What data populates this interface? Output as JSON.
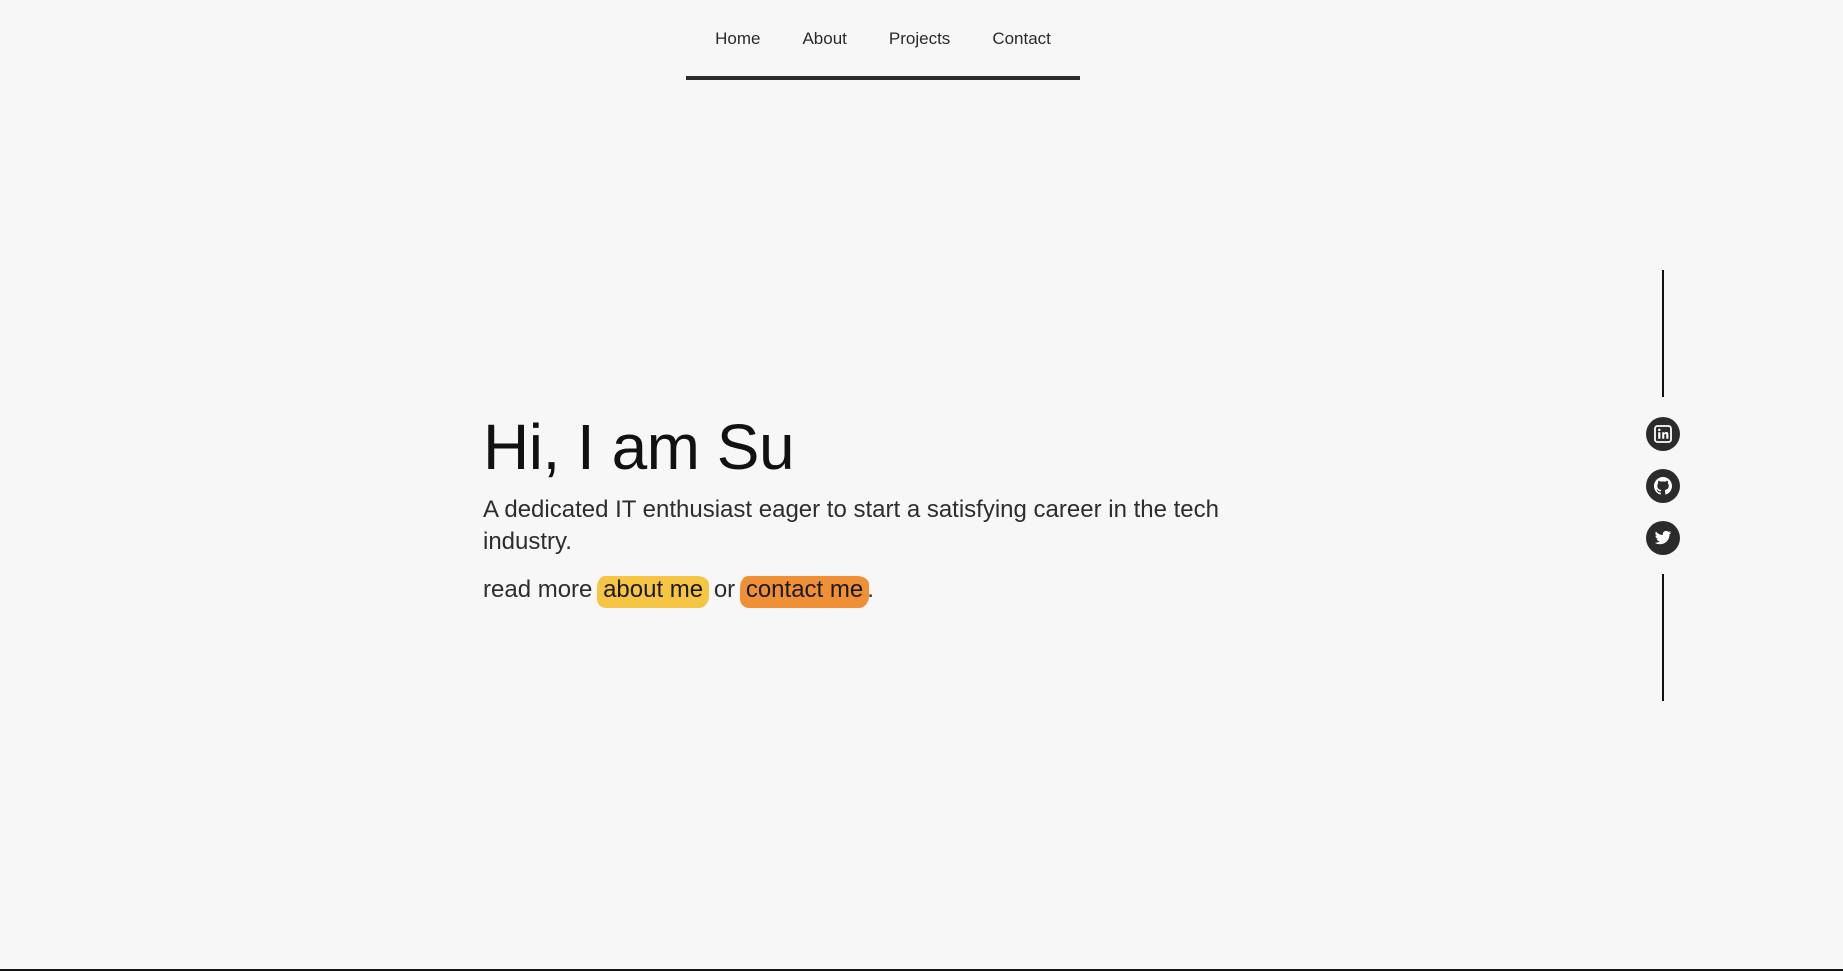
{
  "nav": {
    "items": [
      {
        "label": "Home"
      },
      {
        "label": "About"
      },
      {
        "label": "Projects"
      },
      {
        "label": "Contact"
      }
    ]
  },
  "hero": {
    "title": "Hi, I am Su",
    "subtitle": "A dedicated IT enthusiast eager to start a satisfying career in the tech industry.",
    "links_prefix": "read more",
    "about_link": "about me",
    "links_middle": "or",
    "contact_link": "contact me",
    "links_suffix": "."
  },
  "social": {
    "icons": [
      "linkedin-icon",
      "github-icon",
      "twitter-icon"
    ]
  },
  "colors": {
    "background": "#f7f7f7",
    "text": "#111111",
    "accent_yellow": "#f6c23a",
    "accent_orange": "#ee8a2b",
    "icon_bg": "#2b2b2b"
  }
}
